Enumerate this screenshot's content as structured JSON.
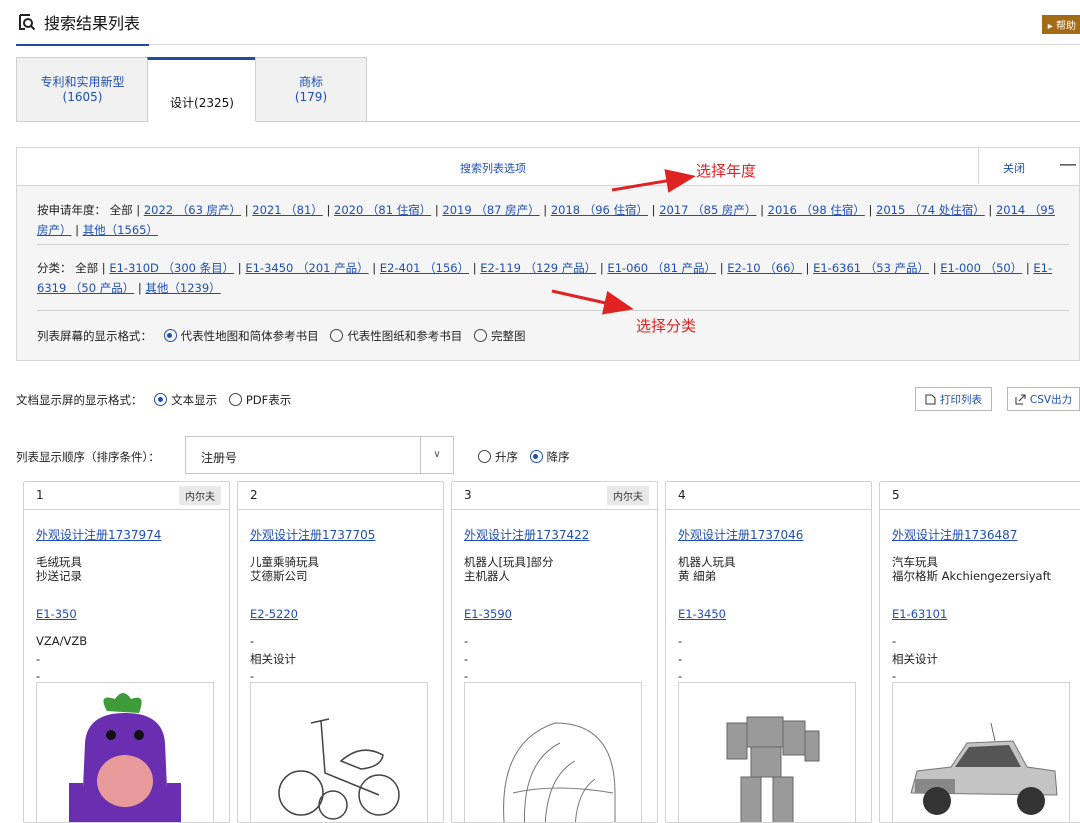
{
  "header": {
    "title": "搜索结果列表",
    "help": "▸ 帮助"
  },
  "tabs": [
    {
      "label": "专利和实用新型",
      "count": "(1605)"
    },
    {
      "label": "设计(2325)",
      "count": ""
    },
    {
      "label": "商标",
      "count": "(179)"
    }
  ],
  "panel": {
    "title": "搜索列表选项",
    "close": "关闭",
    "years_label": "按申请年度：",
    "years_all": "全部",
    "years": [
      "2022 （63 房产）",
      "2021 （81）",
      "2020 （81 住宿）",
      "2019 （87 房产）",
      "2018 （96 住宿）",
      "2017 （85 房产）",
      "2016 （98 住宿）",
      "2015 （74 处住宿）",
      "2014 （95 房产）",
      "其他（1565）"
    ],
    "cat_label": "分类：",
    "cat_all": "全部",
    "categories": [
      "E1-310D （300 条目）",
      "E1-3450 （201 产品）",
      "E2-401 （156）",
      "E2-119 （129 产品）",
      "E1-060 （81 产品）",
      "E2-10 （66）",
      "E1-6361 （53 产品）",
      "E1-000 （50）",
      "E1-6319 （50 产品）",
      "其他（1239）"
    ],
    "format_label": "列表屏幕的显示格式：",
    "format_opts": [
      "代表性地图和简体参考书目",
      "代表性图纸和参考书目",
      "完整图"
    ]
  },
  "annotations": {
    "year": "选择年度",
    "cat": "选择分类"
  },
  "doc_format": {
    "label": "文档显示屏的显示格式：",
    "opt1": "文本显示",
    "opt2": "PDF表示"
  },
  "buttons": {
    "print": "打印列表",
    "csv": "CSV出力"
  },
  "sort": {
    "label": "列表显示顺序（排序条件）：",
    "value": "注册号",
    "asc": "升序",
    "desc": "降序"
  },
  "cards": [
    {
      "num": "1",
      "badge": "内尔夫",
      "reg": "外观设计注册1737974",
      "l1": "毛绒玩具",
      "l2": "抄送记录",
      "cls": "E1-350",
      "a": "VZA/VZB",
      "b": "-",
      "c": "-"
    },
    {
      "num": "2",
      "badge": "",
      "reg": "外观设计注册1737705",
      "l1": "儿童乘骑玩具",
      "l2": "艾德斯公司",
      "cls": "E2-5220",
      "a": "-",
      "b": "相关设计",
      "c": "-"
    },
    {
      "num": "3",
      "badge": "内尔夫",
      "reg": "外观设计注册1737422",
      "l1": "机器人[玩具]部分",
      "l2": "主机器人",
      "cls": "E1-3590",
      "a": "-",
      "b": "-",
      "c": "-"
    },
    {
      "num": "4",
      "badge": "",
      "reg": "外观设计注册1737046",
      "l1": "机器人玩具",
      "l2": "黄 細弟",
      "cls": "E1-3450",
      "a": "-",
      "b": "-",
      "c": "-"
    },
    {
      "num": "5",
      "badge": "",
      "reg": "外观设计注册1736487",
      "l1": "汽车玩具",
      "l2": "福尔格斯 Akchiengezersiyaft",
      "cls": "E1-63101",
      "a": "-",
      "b": "相关设计",
      "c": "-"
    }
  ]
}
